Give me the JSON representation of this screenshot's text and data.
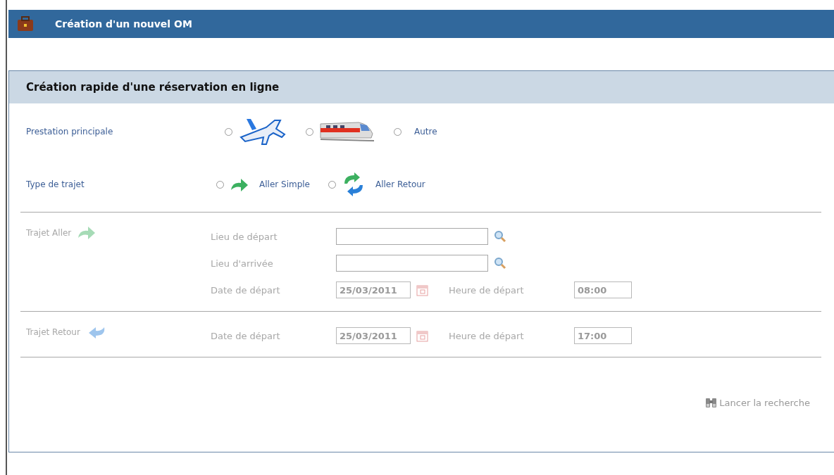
{
  "header": {
    "title": "Création d'un nouvel OM"
  },
  "panel": {
    "title": "Création rapide d'une réservation en ligne",
    "prestation": {
      "label": "Prestation principale",
      "options": [
        {
          "kind": "plane",
          "selected": false
        },
        {
          "kind": "train",
          "selected": false
        },
        {
          "kind": "text",
          "label": "Autre",
          "selected": false
        }
      ]
    },
    "type_trajet": {
      "label": "Type de trajet",
      "options": [
        {
          "kind": "oneway",
          "label": "Aller Simple",
          "selected": false
        },
        {
          "kind": "roundtrip",
          "label": "Aller Retour",
          "selected": false
        }
      ]
    },
    "sections": [
      {
        "label": "Trajet Aller",
        "kind": "outbound",
        "disabled": true,
        "fields": [
          {
            "kind": "place",
            "label": "Lieu de départ"
          },
          {
            "kind": "place",
            "label": "Lieu d'arrivée"
          },
          {
            "kind": "datetime",
            "label": "Date de départ",
            "value": "25/03/2011",
            "time_label": "Heure de départ",
            "time_value": "08:00"
          }
        ]
      },
      {
        "label": "Trajet Retour",
        "kind": "return",
        "disabled": true,
        "fields": [
          {
            "kind": "datetime",
            "label": "Date de départ",
            "value": "25/03/2011",
            "time_label": "Heure de départ",
            "time_value": "17:00"
          }
        ]
      }
    ],
    "search_button": {
      "label": "Lancer la recherche",
      "disabled": true
    }
  }
}
